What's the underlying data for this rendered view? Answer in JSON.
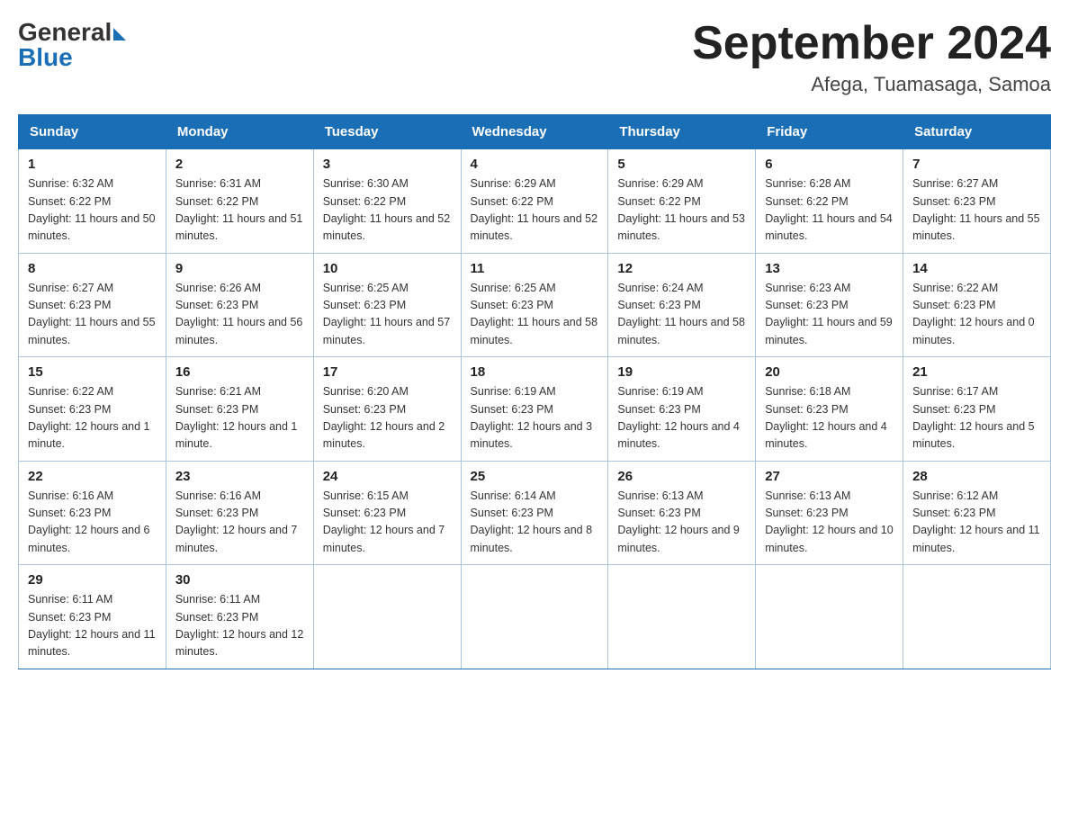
{
  "logo": {
    "general": "General",
    "blue": "Blue"
  },
  "header": {
    "month_year": "September 2024",
    "location": "Afega, Tuamasaga, Samoa"
  },
  "days_of_week": [
    "Sunday",
    "Monday",
    "Tuesday",
    "Wednesday",
    "Thursday",
    "Friday",
    "Saturday"
  ],
  "weeks": [
    [
      {
        "day": "1",
        "sunrise": "6:32 AM",
        "sunset": "6:22 PM",
        "daylight": "11 hours and 50 minutes."
      },
      {
        "day": "2",
        "sunrise": "6:31 AM",
        "sunset": "6:22 PM",
        "daylight": "11 hours and 51 minutes."
      },
      {
        "day": "3",
        "sunrise": "6:30 AM",
        "sunset": "6:22 PM",
        "daylight": "11 hours and 52 minutes."
      },
      {
        "day": "4",
        "sunrise": "6:29 AM",
        "sunset": "6:22 PM",
        "daylight": "11 hours and 52 minutes."
      },
      {
        "day": "5",
        "sunrise": "6:29 AM",
        "sunset": "6:22 PM",
        "daylight": "11 hours and 53 minutes."
      },
      {
        "day": "6",
        "sunrise": "6:28 AM",
        "sunset": "6:22 PM",
        "daylight": "11 hours and 54 minutes."
      },
      {
        "day": "7",
        "sunrise": "6:27 AM",
        "sunset": "6:23 PM",
        "daylight": "11 hours and 55 minutes."
      }
    ],
    [
      {
        "day": "8",
        "sunrise": "6:27 AM",
        "sunset": "6:23 PM",
        "daylight": "11 hours and 55 minutes."
      },
      {
        "day": "9",
        "sunrise": "6:26 AM",
        "sunset": "6:23 PM",
        "daylight": "11 hours and 56 minutes."
      },
      {
        "day": "10",
        "sunrise": "6:25 AM",
        "sunset": "6:23 PM",
        "daylight": "11 hours and 57 minutes."
      },
      {
        "day": "11",
        "sunrise": "6:25 AM",
        "sunset": "6:23 PM",
        "daylight": "11 hours and 58 minutes."
      },
      {
        "day": "12",
        "sunrise": "6:24 AM",
        "sunset": "6:23 PM",
        "daylight": "11 hours and 58 minutes."
      },
      {
        "day": "13",
        "sunrise": "6:23 AM",
        "sunset": "6:23 PM",
        "daylight": "11 hours and 59 minutes."
      },
      {
        "day": "14",
        "sunrise": "6:22 AM",
        "sunset": "6:23 PM",
        "daylight": "12 hours and 0 minutes."
      }
    ],
    [
      {
        "day": "15",
        "sunrise": "6:22 AM",
        "sunset": "6:23 PM",
        "daylight": "12 hours and 1 minute."
      },
      {
        "day": "16",
        "sunrise": "6:21 AM",
        "sunset": "6:23 PM",
        "daylight": "12 hours and 1 minute."
      },
      {
        "day": "17",
        "sunrise": "6:20 AM",
        "sunset": "6:23 PM",
        "daylight": "12 hours and 2 minutes."
      },
      {
        "day": "18",
        "sunrise": "6:19 AM",
        "sunset": "6:23 PM",
        "daylight": "12 hours and 3 minutes."
      },
      {
        "day": "19",
        "sunrise": "6:19 AM",
        "sunset": "6:23 PM",
        "daylight": "12 hours and 4 minutes."
      },
      {
        "day": "20",
        "sunrise": "6:18 AM",
        "sunset": "6:23 PM",
        "daylight": "12 hours and 4 minutes."
      },
      {
        "day": "21",
        "sunrise": "6:17 AM",
        "sunset": "6:23 PM",
        "daylight": "12 hours and 5 minutes."
      }
    ],
    [
      {
        "day": "22",
        "sunrise": "6:16 AM",
        "sunset": "6:23 PM",
        "daylight": "12 hours and 6 minutes."
      },
      {
        "day": "23",
        "sunrise": "6:16 AM",
        "sunset": "6:23 PM",
        "daylight": "12 hours and 7 minutes."
      },
      {
        "day": "24",
        "sunrise": "6:15 AM",
        "sunset": "6:23 PM",
        "daylight": "12 hours and 7 minutes."
      },
      {
        "day": "25",
        "sunrise": "6:14 AM",
        "sunset": "6:23 PM",
        "daylight": "12 hours and 8 minutes."
      },
      {
        "day": "26",
        "sunrise": "6:13 AM",
        "sunset": "6:23 PM",
        "daylight": "12 hours and 9 minutes."
      },
      {
        "day": "27",
        "sunrise": "6:13 AM",
        "sunset": "6:23 PM",
        "daylight": "12 hours and 10 minutes."
      },
      {
        "day": "28",
        "sunrise": "6:12 AM",
        "sunset": "6:23 PM",
        "daylight": "12 hours and 11 minutes."
      }
    ],
    [
      {
        "day": "29",
        "sunrise": "6:11 AM",
        "sunset": "6:23 PM",
        "daylight": "12 hours and 11 minutes."
      },
      {
        "day": "30",
        "sunrise": "6:11 AM",
        "sunset": "6:23 PM",
        "daylight": "12 hours and 12 minutes."
      },
      null,
      null,
      null,
      null,
      null
    ]
  ],
  "labels": {
    "sunrise": "Sunrise:",
    "sunset": "Sunset:",
    "daylight": "Daylight:"
  }
}
